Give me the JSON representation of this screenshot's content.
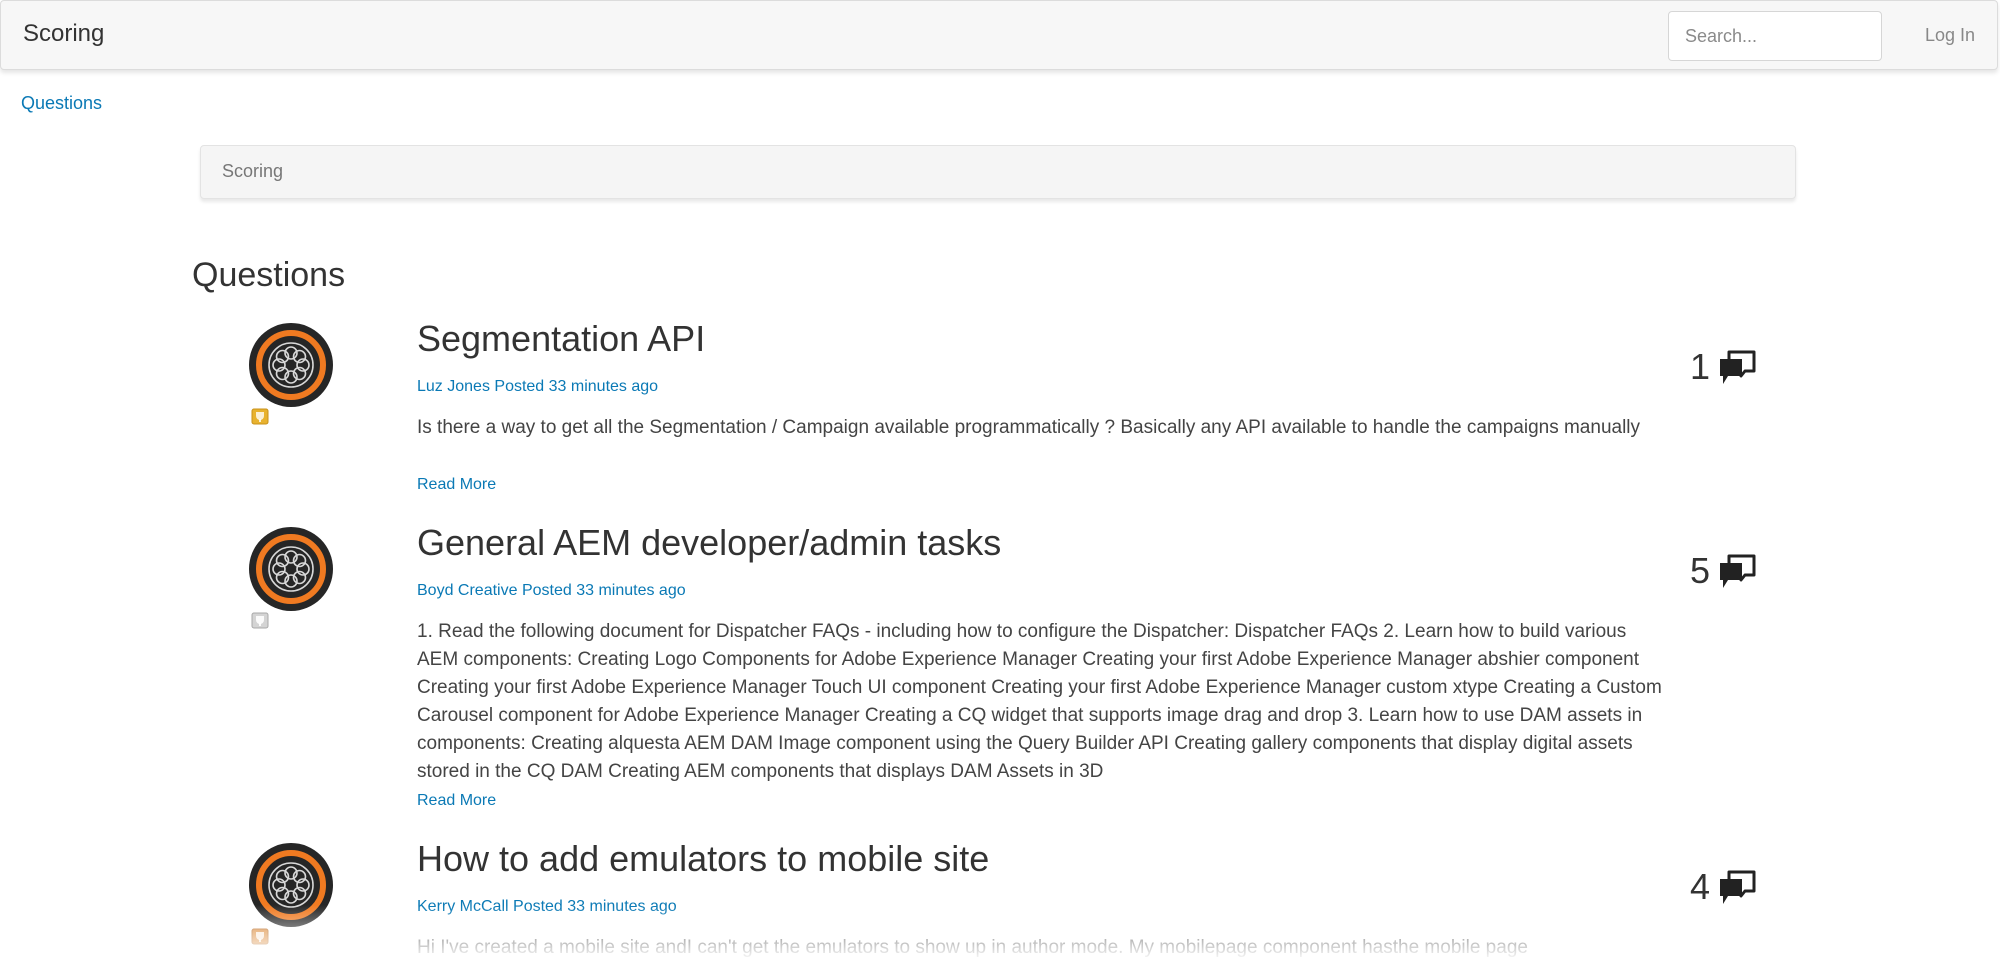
{
  "navbar": {
    "brand": "Scoring",
    "search_placeholder": "Search...",
    "login": "Log In"
  },
  "breadcrumb": {
    "link": "Questions"
  },
  "panel": {
    "title": "Scoring"
  },
  "section": {
    "title": "Questions"
  },
  "questions": [
    {
      "title": "Segmentation API",
      "author": "Luz Jones",
      "posted": "Posted 33 minutes ago",
      "body": "Is there a way to get all the Segmentation / Campaign available programmatically ? Basically any API available to handle the campaigns manually",
      "read_more": "Read More",
      "reply_count": "1",
      "badge_color": "#e8b22e"
    },
    {
      "title": "General AEM developer/admin tasks",
      "author": "Boyd Creative",
      "posted": "Posted 33 minutes ago",
      "body": "1. Read the following document for Dispatcher FAQs - including how to configure the Dispatcher: Dispatcher FAQs 2. Learn how to build various AEM components: Creating Logo Components for Adobe Experience Manager Creating your first Adobe Experience Manager abshier component Creating your first Adobe Experience Manager Touch UI component Creating your first Adobe Experience Manager custom xtype Creating a Custom Carousel component for Adobe Experience Manager Creating a CQ widget that supports image drag and drop 3. Learn how to use DAM assets in components: Creating alquesta AEM DAM Image component using the Query Builder API Creating gallery components that display digital assets stored in the CQ DAM Creating AEM components that displays DAM Assets in 3D",
      "read_more": "Read More",
      "reply_count": "5",
      "badge_color": "#bdbdbd"
    },
    {
      "title": "How to add emulators to mobile site",
      "author": "Kerry McCall",
      "posted": "Posted 33 minutes ago",
      "body": "Hi I've created a mobile site andI can't get the emulators to show up in author mode. My mobilepage component hasthe mobile page",
      "reply_count": "4",
      "badge_color": "#d9822b"
    }
  ],
  "colors": {
    "link": "#0a79b5",
    "avatar_ring": "#f07a21",
    "avatar_bg": "#262626"
  },
  "icons": {
    "reply": "comment-bubbles-icon",
    "badge": "rank-badge-icon",
    "avatar": "adobe-experience-manager-logo"
  }
}
